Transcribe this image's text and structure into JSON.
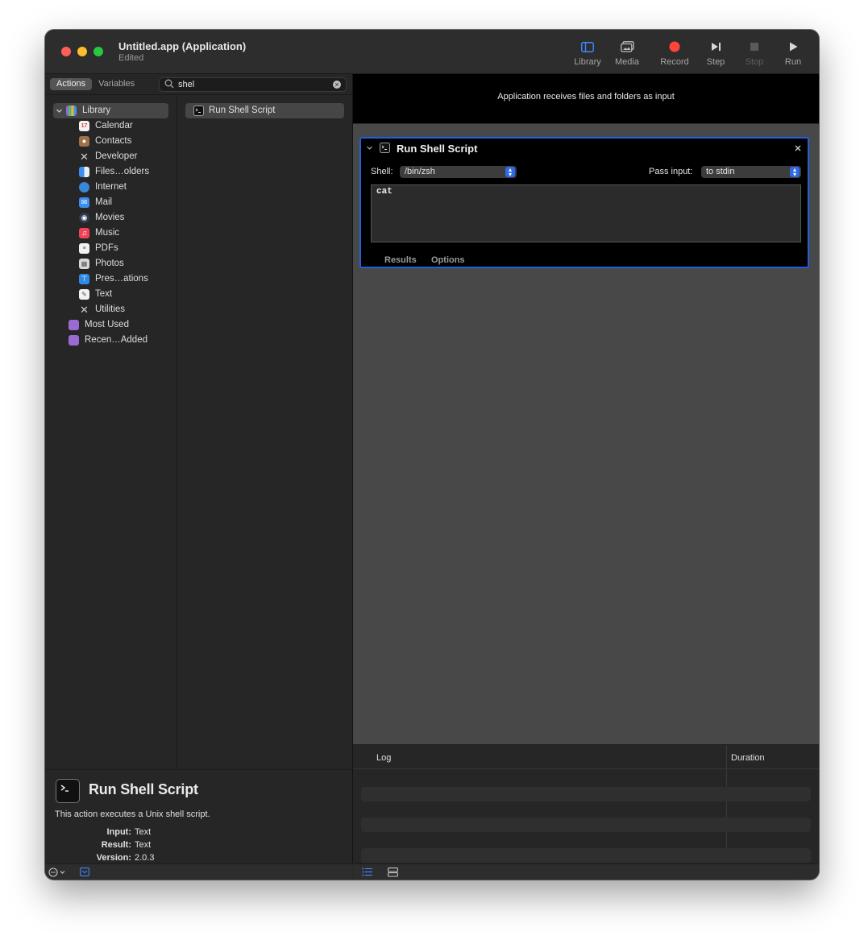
{
  "window": {
    "title": "Untitled.app (Application)",
    "subtitle": "Edited"
  },
  "toolbar": [
    {
      "label": "Library",
      "icon": "sidebar-icon",
      "enabled": true,
      "color": "#3d8bff"
    },
    {
      "label": "Media",
      "icon": "media-icon",
      "enabled": true
    },
    {
      "label": "Record",
      "icon": "record-icon",
      "enabled": true,
      "color": "#ff453a"
    },
    {
      "label": "Step",
      "icon": "step-icon",
      "enabled": true
    },
    {
      "label": "Stop",
      "icon": "stop-icon",
      "enabled": false
    },
    {
      "label": "Run",
      "icon": "play-icon",
      "enabled": true
    }
  ],
  "library": {
    "tabs": [
      "Actions",
      "Variables"
    ],
    "active_tab": "Actions",
    "search": {
      "value": "shel",
      "placeholder": ""
    },
    "tree": [
      {
        "label": "Library",
        "icon": "library-icon",
        "level": 0,
        "expanded": true,
        "selected": true
      },
      {
        "label": "Calendar",
        "icon": "calendar-icon",
        "level": 1
      },
      {
        "label": "Contacts",
        "icon": "contacts-icon",
        "level": 1
      },
      {
        "label": "Developer",
        "icon": "developer-icon",
        "level": 1
      },
      {
        "label": "Files…olders",
        "icon": "finder-icon",
        "level": 1
      },
      {
        "label": "Internet",
        "icon": "globe-icon",
        "level": 1
      },
      {
        "label": "Mail",
        "icon": "mail-icon",
        "level": 1
      },
      {
        "label": "Movies",
        "icon": "movies-icon",
        "level": 1
      },
      {
        "label": "Music",
        "icon": "music-icon",
        "level": 1
      },
      {
        "label": "PDFs",
        "icon": "pdf-icon",
        "level": 1
      },
      {
        "label": "Photos",
        "icon": "photos-icon",
        "level": 1
      },
      {
        "label": "Pres…ations",
        "icon": "presentations-icon",
        "level": 1
      },
      {
        "label": "Text",
        "icon": "text-icon",
        "level": 1
      },
      {
        "label": "Utilities",
        "icon": "utilities-icon",
        "level": 1
      },
      {
        "label": "Most Used",
        "icon": "smart-folder-icon",
        "level": 0
      },
      {
        "label": "Recen…Added",
        "icon": "smart-folder-icon",
        "level": 0
      }
    ],
    "actions": [
      {
        "label": "Run Shell Script",
        "icon": "terminal-icon"
      }
    ]
  },
  "description": {
    "title": "Run Shell Script",
    "text": "This action executes a Unix shell script.",
    "meta": [
      {
        "key": "Input:",
        "value": "Text"
      },
      {
        "key": "Result:",
        "value": "Text"
      },
      {
        "key": "Version:",
        "value": "2.0.3"
      }
    ]
  },
  "workflow": {
    "header": "Application receives files and folders as input",
    "action": {
      "title": "Run Shell Script",
      "shell_label": "Shell:",
      "shell_value": "/bin/zsh",
      "pass_label": "Pass input:",
      "pass_value": "to stdin",
      "script": "cat",
      "tabs": [
        "Results",
        "Options"
      ]
    }
  },
  "log": {
    "columns": [
      "Log",
      "Duration"
    ]
  },
  "colors": {
    "accent": "#1f5fe0",
    "close": "#ff5f57",
    "minimize": "#febc2e",
    "maximize": "#28c840"
  }
}
